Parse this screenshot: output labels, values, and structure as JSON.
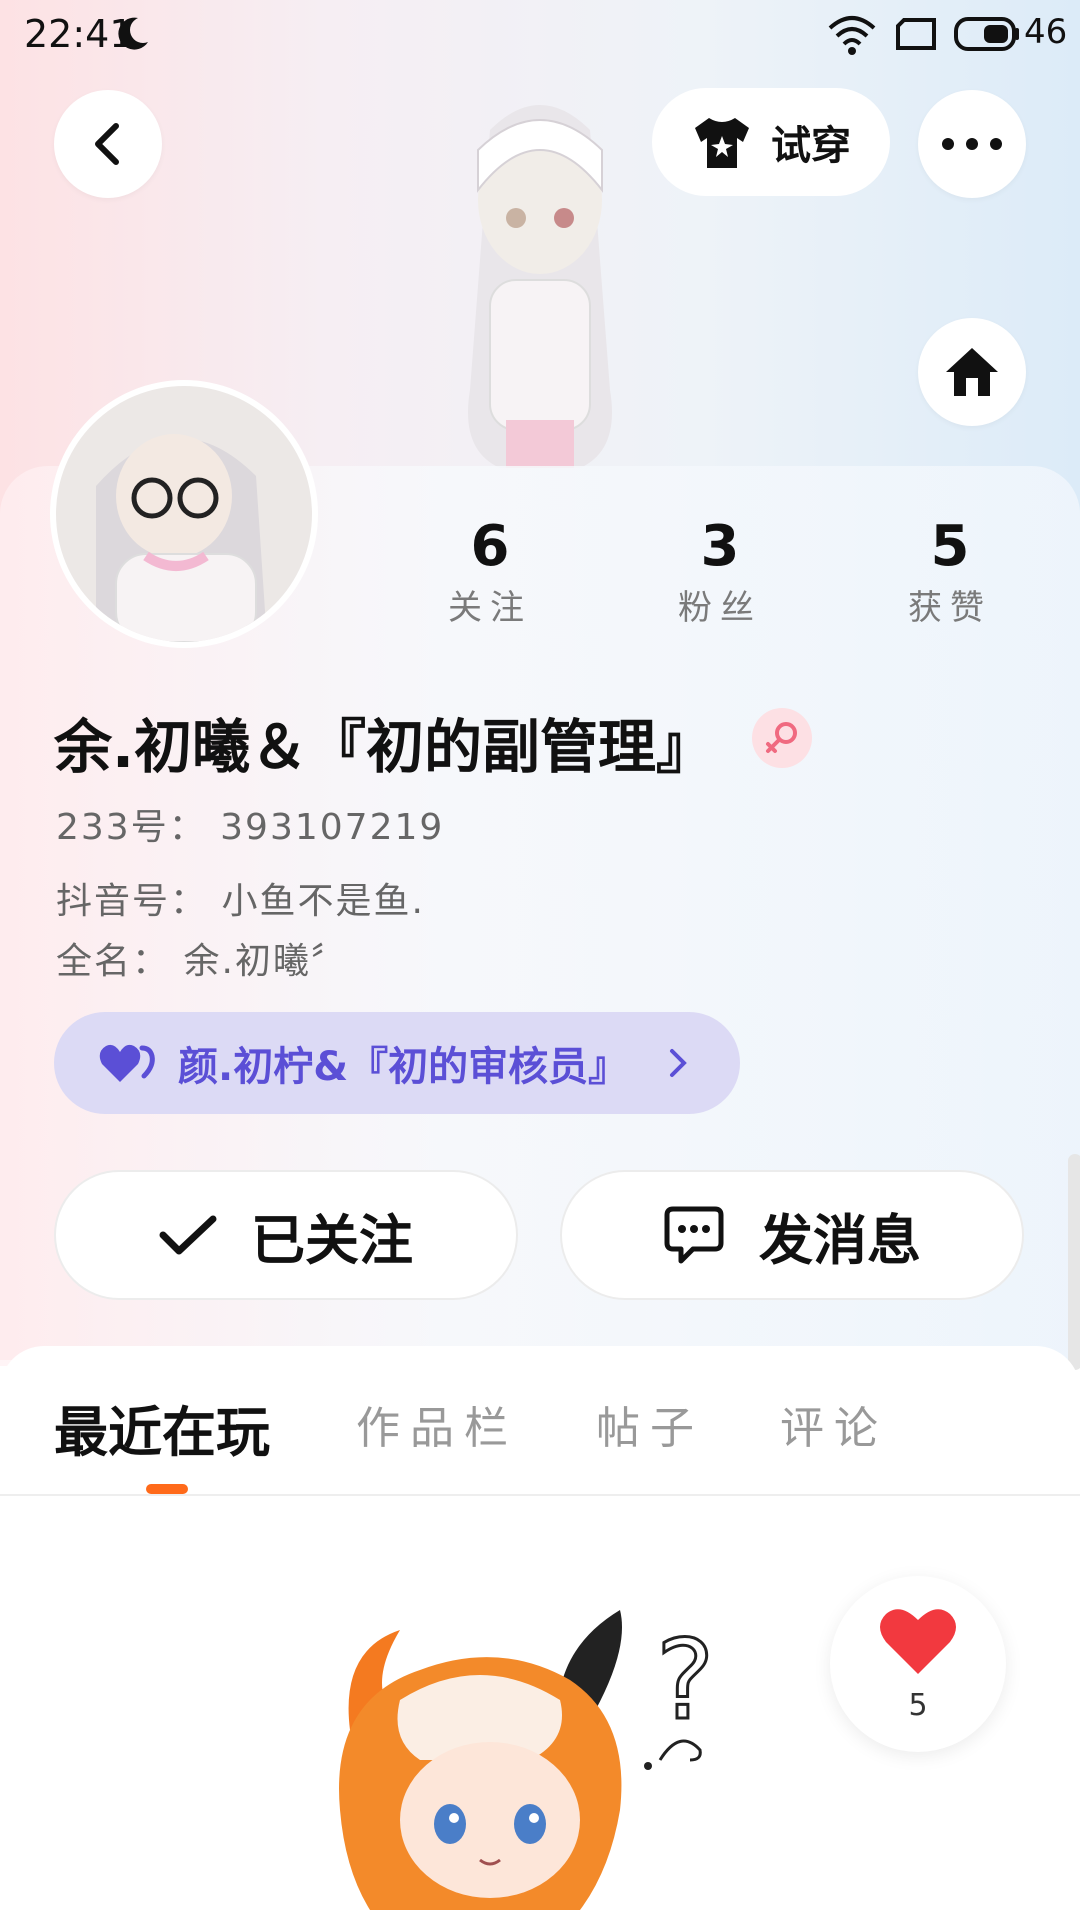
{
  "status_bar": {
    "time": "22:41",
    "battery": "46"
  },
  "header": {
    "try_on_label": "试穿"
  },
  "stats": [
    {
      "count": "6",
      "label": "关注"
    },
    {
      "count": "3",
      "label": "粉丝"
    },
    {
      "count": "5",
      "label": "获赞"
    }
  ],
  "profile": {
    "name": "余.初曦＆『初的副管理』",
    "id_line": "233号： 393107219",
    "bio_line1": "抖音号： 小鱼不是鱼.",
    "bio_line2": "全名： 余.初曦〞"
  },
  "relation": {
    "label": "颜.初柠&『初的审核员』"
  },
  "actions": {
    "followed_label": "已关注",
    "message_label": "发消息"
  },
  "tabs": [
    "最近在玩",
    "作品栏",
    "帖子",
    "评论"
  ],
  "like": {
    "count": "5"
  },
  "colors": {
    "accent": "#ff6a1a",
    "relation_bg": "#dcdaf5",
    "relation_text": "#5b4fd6",
    "female_badge": "#f06a80"
  }
}
